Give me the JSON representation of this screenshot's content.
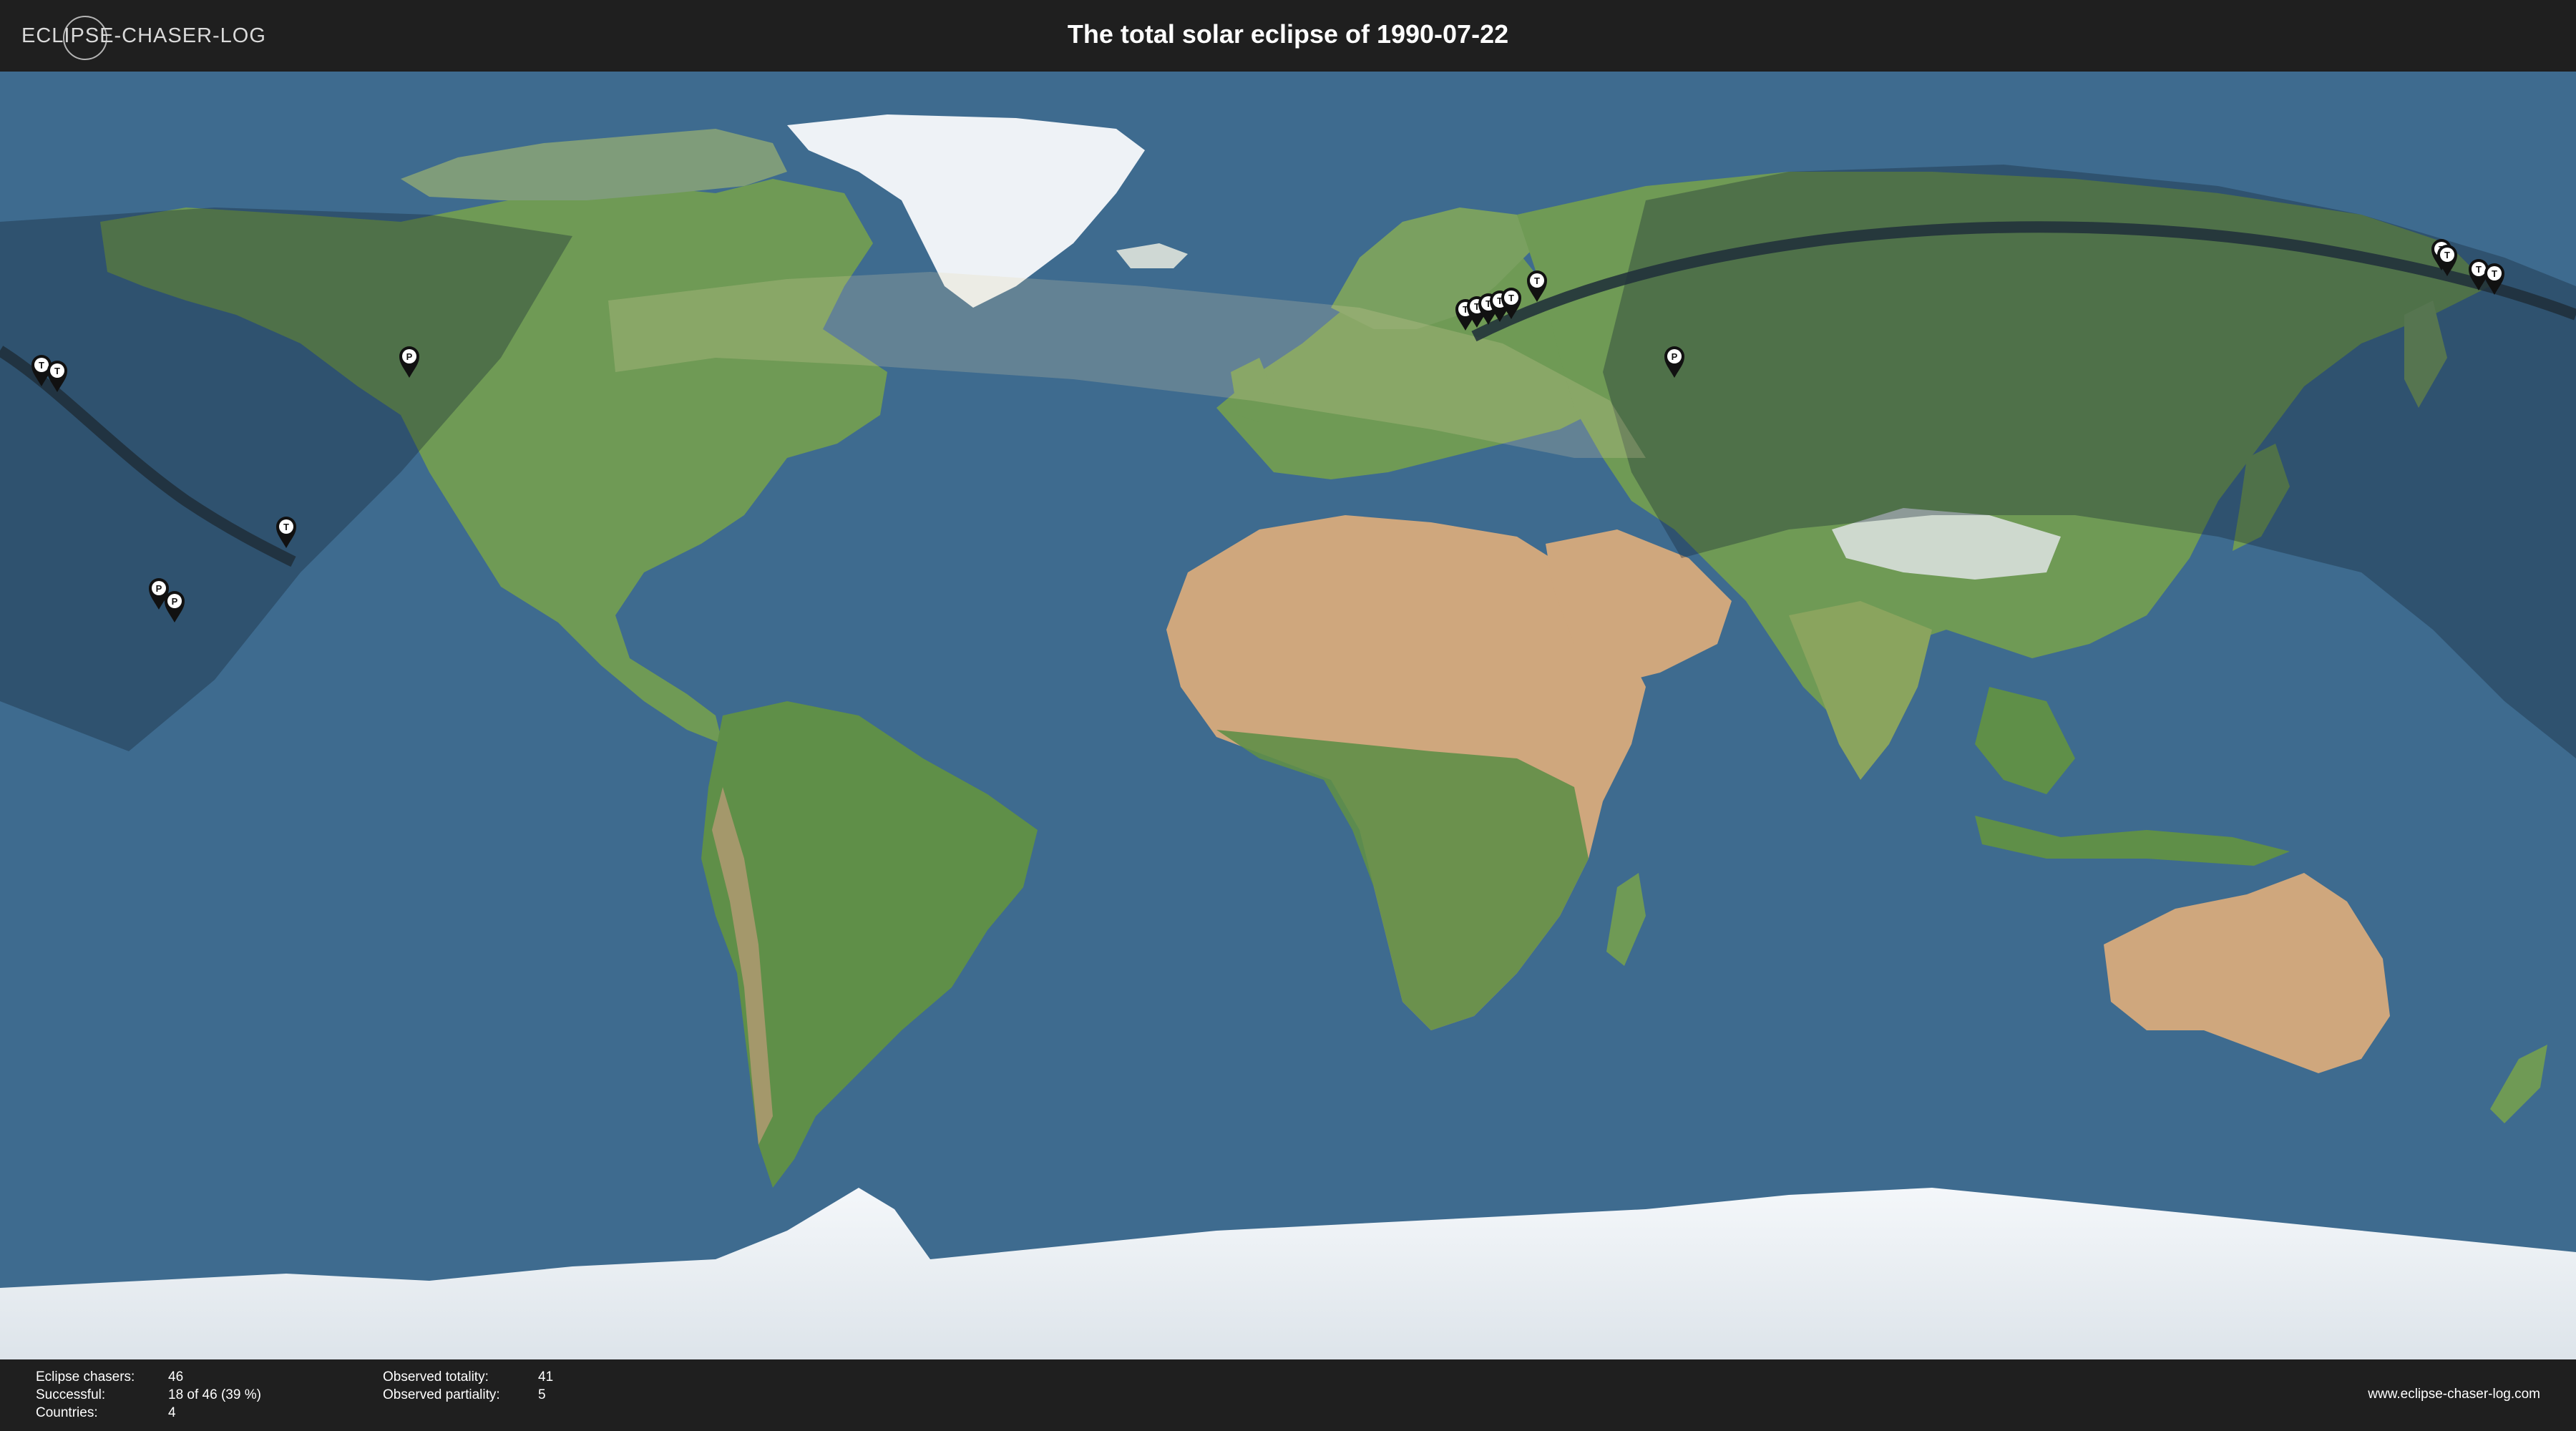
{
  "header": {
    "logo_text": "ECLIPSE-CHASER-LOG",
    "title": "The total solar eclipse of 1990-07-22"
  },
  "footer": {
    "stats_left": [
      {
        "label": "Eclipse chasers:",
        "value": "46"
      },
      {
        "label": "Successful:",
        "value": "18 of 46 (39 %)"
      },
      {
        "label": "Countries:",
        "value": "4"
      }
    ],
    "stats_right": [
      {
        "label": "Observed totality:",
        "value": "41"
      },
      {
        "label": "Observed partiality:",
        "value": "5"
      }
    ],
    "website": "www.eclipse-chaser-log.com"
  },
  "map": {
    "markers": [
      {
        "type": "total",
        "label": "T"
      },
      {
        "type": "total",
        "label": "T"
      },
      {
        "type": "partial",
        "label": "P"
      },
      {
        "type": "total",
        "label": "T"
      },
      {
        "type": "partial",
        "label": "P"
      },
      {
        "type": "partial",
        "label": "P"
      },
      {
        "type": "total",
        "label": "T"
      },
      {
        "type": "total",
        "label": "T"
      },
      {
        "type": "total",
        "label": "T"
      },
      {
        "type": "total",
        "label": "T"
      },
      {
        "type": "total",
        "label": "T"
      },
      {
        "type": "total",
        "label": "T"
      },
      {
        "type": "partial",
        "label": "P"
      },
      {
        "type": "total",
        "label": "T"
      },
      {
        "type": "total",
        "label": "T"
      },
      {
        "type": "total",
        "label": "T"
      },
      {
        "type": "total",
        "label": "T"
      }
    ],
    "colors": {
      "ocean": "#3e6b8f",
      "land": "#6f9a55",
      "desert": "#c9a277",
      "ice": "#eef2f6",
      "umbra_path": "#1e2e3a",
      "penumbra_shade": "#142433",
      "penumbra_light": "#e8d6a8"
    }
  }
}
